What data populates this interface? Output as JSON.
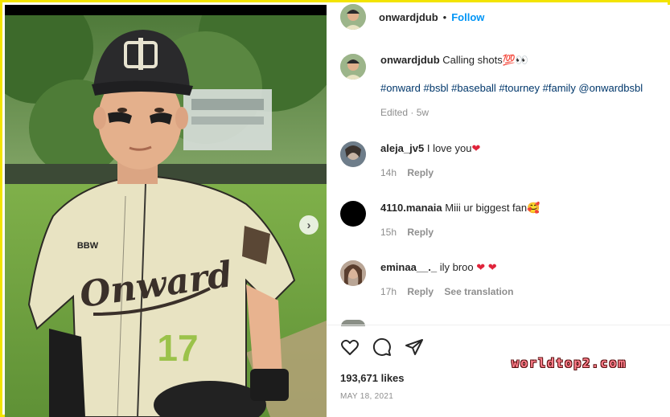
{
  "post": {
    "username": "onwardjdub",
    "follow_label": "Follow",
    "separator": "•"
  },
  "caption": {
    "username": "onwardjdub",
    "text": "Calling shots💯👀",
    "hashtags": "#onward #bsbl #baseball #tourney #family @onwardbsbl",
    "edited": "Edited",
    "age": "5w"
  },
  "comments": [
    {
      "username": "aleja_jv5",
      "text": "I love you",
      "emoji": "❤",
      "age": "14h",
      "reply": "Reply"
    },
    {
      "username": "4110.manaia",
      "text": "Miii ur biggest fan",
      "emoji": "🥰",
      "age": "15h",
      "reply": "Reply"
    },
    {
      "username": "eminaa__._",
      "text": "ily broo",
      "emoji": "❤ ❤",
      "age": "17h",
      "reply": "Reply",
      "translate": "See translation"
    }
  ],
  "footer": {
    "likes": "193,671 likes",
    "date": "MAY 18, 2021",
    "watermark": "worldtop2.com"
  },
  "colors": {
    "accent": "#0095f6",
    "border": "#f3e400",
    "heart": "#e0243b"
  },
  "icons": [
    "heart-icon",
    "comment-icon",
    "share-icon",
    "carousel-next-icon"
  ],
  "photo_text": {
    "jersey": "Onward",
    "number": "17",
    "sleeve": "BBW"
  }
}
